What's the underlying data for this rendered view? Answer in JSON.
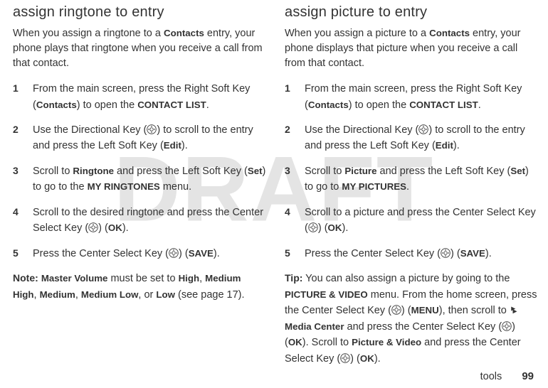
{
  "watermark": "DRAFT",
  "left": {
    "heading": "assign ringtone to entry",
    "intro_pre": "When you assign a ringtone to a ",
    "intro_bold1": "Contacts",
    "intro_post": " entry, your phone plays that ringtone when you receive a call from that contact.",
    "steps": [
      {
        "n": "1",
        "parts": [
          "From the main screen, press the Right Soft Key (",
          "Contacts",
          ") to open the ",
          "CONTACT LIST",
          "."
        ]
      },
      {
        "n": "2",
        "parts": [
          "Use the Directional Key (",
          "ICON_DIR",
          ") to scroll to the entry and press the Left Soft Key (",
          "Edit",
          ")."
        ]
      },
      {
        "n": "3",
        "parts": [
          "Scroll to ",
          "Ringtone",
          " and press the Left Soft Key (",
          "Set",
          ") to go to the ",
          "MY RINGTONES",
          " menu."
        ]
      },
      {
        "n": "4",
        "parts": [
          "Scroll to the desired ringtone and press the Center Select Key (",
          "ICON_DIR",
          ") (",
          "OK",
          ")."
        ]
      },
      {
        "n": "5",
        "parts": [
          "Press the Center Select Key (",
          "ICON_DIR",
          ") (",
          "SAVE",
          ")."
        ]
      }
    ],
    "note_label": "Note:",
    "note_parts": [
      " ",
      "Master Volume",
      " must be set to ",
      "High",
      ", ",
      "Medium High",
      ", ",
      "Medium",
      ", ",
      "Medium Low",
      ", or ",
      "Low",
      " (see page 17)."
    ]
  },
  "right": {
    "heading": "assign picture to entry",
    "intro_pre": "When you assign a picture to a ",
    "intro_bold1": "Contacts",
    "intro_post": " entry, your phone displays that picture when you receive a call from that contact.",
    "steps": [
      {
        "n": "1",
        "parts": [
          "From the main screen, press the Right Soft Key (",
          "Contacts",
          ") to open the ",
          "CONTACT LIST",
          "."
        ]
      },
      {
        "n": "2",
        "parts": [
          "Use the Directional Key (",
          "ICON_DIR",
          ") to scroll to the entry and press the Left Soft Key (",
          "Edit",
          ")."
        ]
      },
      {
        "n": "3",
        "parts": [
          "Scroll to ",
          "Picture",
          " and press the Left Soft Key (",
          "Set",
          ") to go to ",
          "MY PICTURES",
          "."
        ]
      },
      {
        "n": "4",
        "parts": [
          "Scroll to a picture and press the Center Select Key (",
          "ICON_DIR",
          ") (",
          "OK",
          ")."
        ]
      },
      {
        "n": "5",
        "parts": [
          "Press the Center Select Key (",
          "ICON_DIR",
          ") (",
          "SAVE",
          ")."
        ]
      }
    ],
    "tip_label": "Tip:",
    "tip_parts": [
      " You can also assign a picture by going to the ",
      "PICTURE & VIDEO",
      " menu. From the home screen, press the Center Select Key (",
      "ICON_DIR",
      ") (",
      "MENU",
      "), then scroll to ",
      "ICON_MC",
      " ",
      "Media Center",
      " and press the Center Select Key (",
      "ICON_DIR",
      ") (",
      "OK",
      "). Scroll to ",
      "Picture & Video",
      " and press the Center Select Key (",
      "ICON_DIR",
      ") (",
      "OK",
      ")."
    ]
  },
  "footer_label": "tools",
  "footer_page": "99"
}
